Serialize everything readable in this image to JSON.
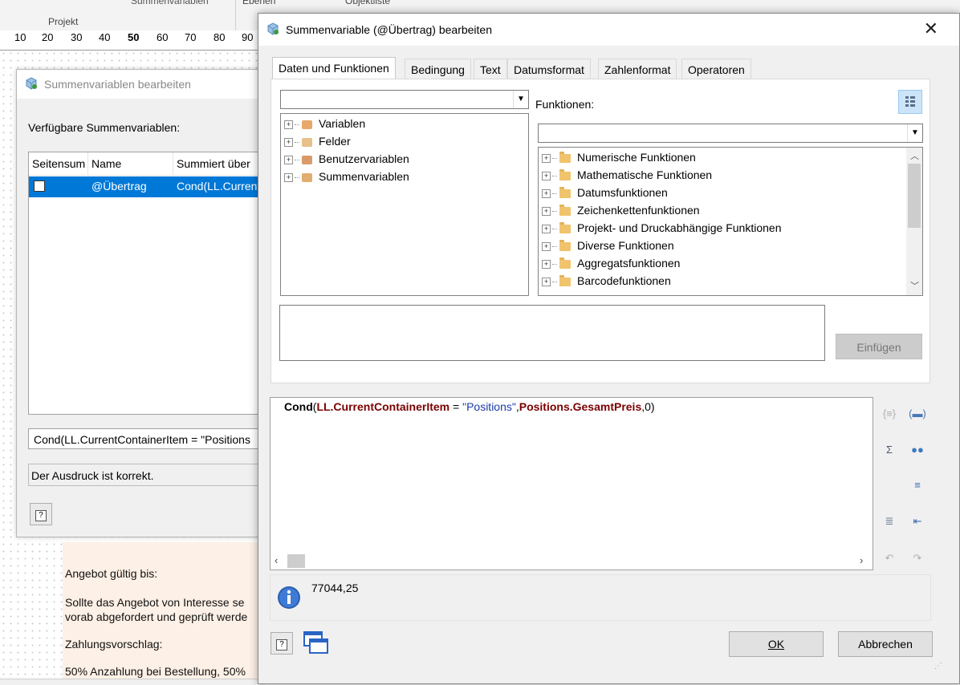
{
  "ribbon": {
    "group_label": "Projekt",
    "summenvariablen_label": "Summenvariablen",
    "ebenen_label": "Ebenen",
    "objektliste_label": "Objektliste"
  },
  "ruler": {
    "ticks": [
      "10",
      "20",
      "30",
      "40",
      "50",
      "60",
      "70",
      "80",
      "90"
    ]
  },
  "document": {
    "lines": [
      "Angebot gültig bis:",
      "Sollte das Angebot von Interesse se",
      "vorab abgefordert und geprüft werde",
      "Zahlungsvorschlag:",
      "50% Anzahlung bei Bestellung, 50%"
    ]
  },
  "back_dialog": {
    "title": "Summenvariablen bearbeiten",
    "available_label": "Verfügbare Summenvariablen:",
    "columns": [
      "Seitensum",
      "Name",
      "Summiert über"
    ],
    "row": {
      "name": "@Übertrag",
      "summed": "Cond(LL.Current"
    },
    "expression": "Cond(LL.CurrentContainerItem = \"Positions",
    "status": "Der Ausdruck ist korrekt.",
    "help_label": "?"
  },
  "dialog": {
    "title": "Summenvariable (@Übertrag) bearbeiten",
    "close_label": "✕",
    "tabs": [
      "Daten und Funktionen",
      "Bedingung",
      "Text",
      "Datumsformat",
      "Zahlenformat",
      "Operatoren"
    ],
    "left_tree": [
      "Variablen",
      "Felder",
      "Benutzervariablen",
      "Summenvariablen"
    ],
    "functions_label": "Funktionen:",
    "function_tree": [
      "Numerische Funktionen",
      "Mathematische Funktionen",
      "Datumsfunktionen",
      "Zeichenkettenfunktionen",
      "Projekt- und Druckabhängige Funktionen",
      "Diverse Funktionen",
      "Aggregatsfunktionen",
      "Barcodefunktionen"
    ],
    "insert_label": "Einfügen",
    "expression": {
      "fn": "Cond",
      "open": "(",
      "field1": "LL.CurrentContainerItem",
      "op": " = ",
      "str": "\"Positions\"",
      "comma1": ",",
      "field2": "Positions.GesamtPreis",
      "tail": ",0)"
    },
    "result_value": "77044,25",
    "ok_label": "OK",
    "cancel_label": "Abbrechen",
    "help_label": "?"
  },
  "colors": {
    "accent": "#0078d7",
    "field_color": "#7b0000",
    "string_color": "#1a3aa8"
  }
}
